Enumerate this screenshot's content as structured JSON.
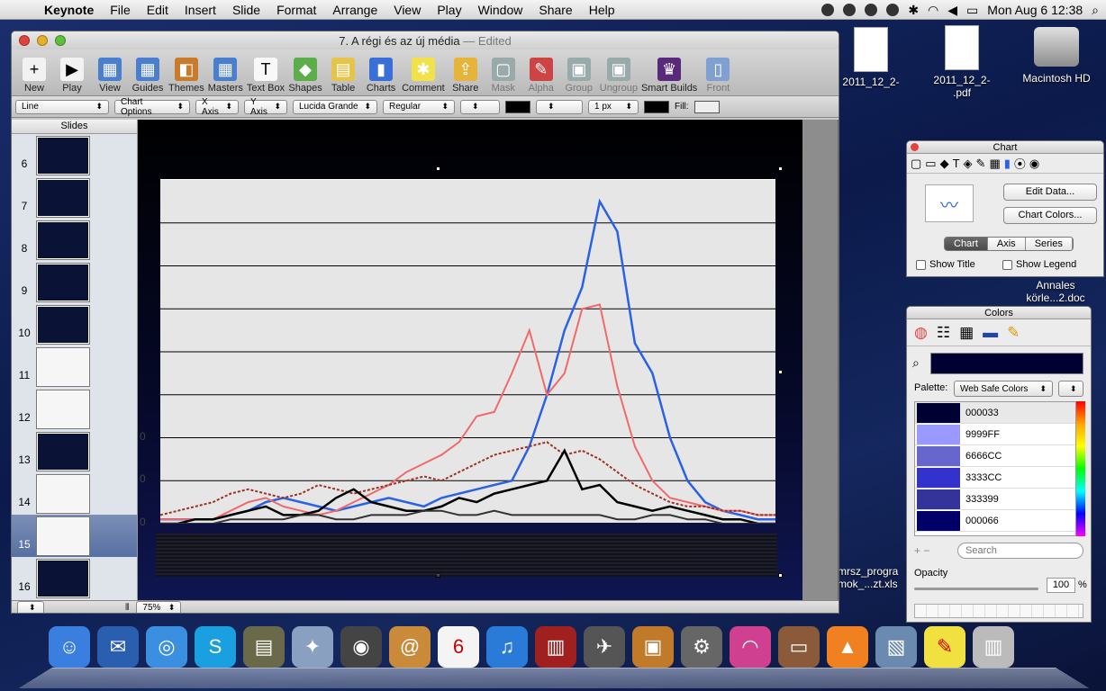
{
  "menubar": {
    "app_name": "Keynote",
    "items": [
      "File",
      "Edit",
      "Insert",
      "Slide",
      "Format",
      "Arrange",
      "View",
      "Play",
      "Window",
      "Share",
      "Help"
    ],
    "clock": "Mon Aug 6  12:38"
  },
  "desktop": {
    "icons": [
      {
        "label": "2011_12_2-"
      },
      {
        "label": "2011_12_2-\n.pdf"
      },
      {
        "label": "Macintosh HD"
      },
      {
        "label": "Annales\nkörle...2.doc"
      },
      {
        "label": "mrsz_progra\nmok_...zt.xls"
      }
    ]
  },
  "window": {
    "title": "7. A régi és az új média",
    "edited": "— Edited",
    "toolbar": [
      {
        "label": "New",
        "icon": "plus-icon"
      },
      {
        "label": "Play",
        "icon": "play-icon"
      },
      {
        "label": "View",
        "icon": "view-icon"
      },
      {
        "label": "Guides",
        "icon": "guides-icon"
      },
      {
        "label": "Themes",
        "icon": "themes-icon"
      },
      {
        "label": "Masters",
        "icon": "masters-icon"
      },
      {
        "label": "Text Box",
        "icon": "textbox-icon"
      },
      {
        "label": "Shapes",
        "icon": "shapes-icon"
      },
      {
        "label": "Table",
        "icon": "table-icon"
      },
      {
        "label": "Charts",
        "icon": "charts-icon"
      },
      {
        "label": "Comment",
        "icon": "comment-icon"
      },
      {
        "label": "Share",
        "icon": "share-icon"
      },
      {
        "label": "Mask",
        "icon": "mask-icon"
      },
      {
        "label": "Alpha",
        "icon": "alpha-icon"
      },
      {
        "label": "Group",
        "icon": "group-icon"
      },
      {
        "label": "Ungroup",
        "icon": "ungroup-icon"
      },
      {
        "label": "Smart Builds",
        "icon": "smart-builds-icon"
      },
      {
        "label": "Front",
        "icon": "front-icon"
      }
    ],
    "format": {
      "style": "Line",
      "chart_options": "Chart Options",
      "x_axis": "X Axis",
      "y_axis": "Y Axis",
      "font": "Lucida Grande",
      "weight": "Regular",
      "stroke_width": "1 px",
      "fill_label": "Fill:"
    },
    "sidebar": {
      "title": "Slides",
      "slides": [
        "6",
        "7",
        "8",
        "9",
        "10",
        "11",
        "12",
        "13",
        "14",
        "15",
        "16"
      ],
      "selected": "15"
    },
    "zoom": "75%"
  },
  "chart_panel": {
    "title": "Chart",
    "edit_data": "Edit Data...",
    "chart_colors": "Chart Colors...",
    "tabs": [
      "Chart",
      "Axis",
      "Series"
    ],
    "active_tab": "Chart",
    "show_title": "Show Title",
    "show_legend": "Show Legend"
  },
  "colors_panel": {
    "title": "Colors",
    "palette_label": "Palette:",
    "palette_value": "Web Safe Colors",
    "swatches": [
      {
        "name": "000033",
        "hex": "#000033"
      },
      {
        "name": "9999FF",
        "hex": "#9999FF"
      },
      {
        "name": "6666CC",
        "hex": "#6666CC"
      },
      {
        "name": "3333CC",
        "hex": "#3333CC"
      },
      {
        "name": "333399",
        "hex": "#333399"
      },
      {
        "name": "000066",
        "hex": "#000066"
      }
    ],
    "search_placeholder": "Search",
    "opacity_label": "Opacity",
    "opacity_value": "100",
    "percent": "%"
  },
  "chart_data": {
    "type": "line",
    "title": "",
    "xlabel": "",
    "ylabel": "",
    "ylim": [
      0,
      8
    ],
    "grid": true,
    "legend": "none",
    "y_tick_labels_visible": [
      "0",
      "0",
      "0"
    ],
    "series": [
      {
        "color": "#2a62e6",
        "values": [
          0.1,
          0.1,
          0.1,
          0.1,
          0.2,
          0.3,
          0.5,
          0.6,
          0.5,
          0.4,
          0.3,
          0.4,
          0.5,
          0.6,
          0.5,
          0.4,
          0.6,
          0.7,
          0.8,
          0.9,
          1.0,
          1.8,
          3.0,
          4.5,
          5.5,
          7.5,
          6.8,
          4.2,
          3.5,
          2.0,
          1.0,
          0.5,
          0.3,
          0.2,
          0.1,
          0.1
        ]
      },
      {
        "color": "#f06a6a",
        "values": [
          0.1,
          0.1,
          0.1,
          0.1,
          0.3,
          0.5,
          0.6,
          0.4,
          0.3,
          0.2,
          0.3,
          0.5,
          0.7,
          0.9,
          1.2,
          1.4,
          1.6,
          1.9,
          2.5,
          2.6,
          3.5,
          4.5,
          3.0,
          3.5,
          5.0,
          5.1,
          3.2,
          1.8,
          1.0,
          0.6,
          0.5,
          0.4,
          0.3,
          0.3,
          0.2,
          0.2
        ]
      },
      {
        "color": "#a03020",
        "dashed": true,
        "values": [
          0.2,
          0.3,
          0.4,
          0.5,
          0.7,
          0.8,
          0.7,
          0.6,
          0.7,
          0.9,
          0.8,
          0.7,
          0.8,
          0.9,
          1.0,
          1.1,
          1.0,
          1.2,
          1.4,
          1.6,
          1.7,
          1.8,
          1.9,
          1.6,
          1.7,
          1.5,
          1.2,
          0.9,
          0.7,
          0.5,
          0.4,
          0.4,
          0.3,
          0.3,
          0.2,
          0.2
        ]
      },
      {
        "color": "#000000",
        "values": [
          0.0,
          0.0,
          0.1,
          0.1,
          0.2,
          0.3,
          0.4,
          0.2,
          0.2,
          0.3,
          0.6,
          0.8,
          0.5,
          0.4,
          0.3,
          0.3,
          0.4,
          0.6,
          0.5,
          0.7,
          0.8,
          0.9,
          1.0,
          1.7,
          0.8,
          0.9,
          0.5,
          0.4,
          0.3,
          0.4,
          0.3,
          0.2,
          0.1,
          0.1,
          0.0,
          0.0
        ]
      },
      {
        "color": "#333333",
        "values": [
          0.0,
          0.0,
          0.0,
          0.0,
          0.1,
          0.1,
          0.1,
          0.1,
          0.2,
          0.2,
          0.1,
          0.1,
          0.2,
          0.2,
          0.2,
          0.3,
          0.3,
          0.2,
          0.2,
          0.3,
          0.2,
          0.2,
          0.2,
          0.2,
          0.2,
          0.2,
          0.1,
          0.1,
          0.2,
          0.2,
          0.1,
          0.1,
          0.0,
          0.0,
          0.0,
          0.0
        ]
      }
    ]
  }
}
